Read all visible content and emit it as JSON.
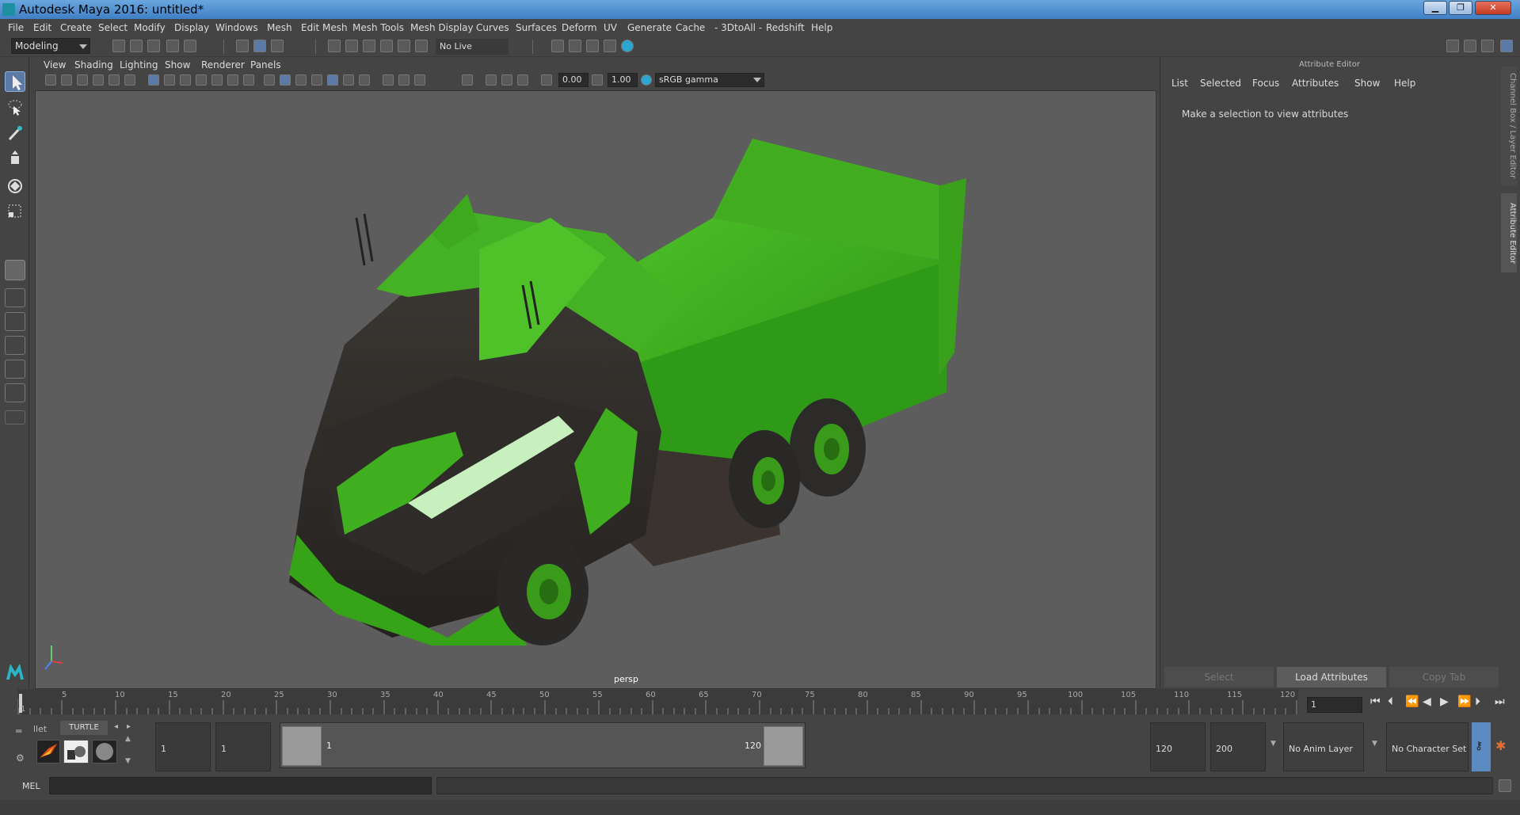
{
  "window": {
    "title": "Autodesk Maya 2016: untitled*",
    "min": "▁",
    "max": "❐",
    "close": "✕"
  },
  "menu": [
    "File",
    "Edit",
    "Create",
    "Select",
    "Modify",
    "Display",
    "Windows",
    "Mesh",
    "Edit Mesh",
    "Mesh Tools",
    "Mesh Display",
    "Curves",
    "Surfaces",
    "Deform",
    "UV",
    "Generate",
    "Cache",
    "- 3DtoAll -",
    "Redshift",
    "Help"
  ],
  "shelf": {
    "mode": "Modeling",
    "live_surface": "No Live Surface"
  },
  "viewport": {
    "menu": [
      "View",
      "Shading",
      "Lighting",
      "Show",
      "Renderer",
      "Panels"
    ],
    "exposure": "0.00",
    "gamma": "1.00",
    "color_space": "sRGB gamma",
    "camera": "persp"
  },
  "attribute_editor": {
    "title": "Attribute Editor",
    "menu": [
      "List",
      "Selected",
      "Focus",
      "Attributes",
      "Show",
      "Help"
    ],
    "message": "Make a selection to view attributes",
    "buttons": {
      "select": "Select",
      "load": "Load Attributes",
      "copy": "Copy Tab"
    },
    "side_tabs": {
      "channel_box": "Channel Box / Layer Editor",
      "attr_editor": "Attribute Editor"
    }
  },
  "timeline": {
    "ticks": [
      "5",
      "10",
      "15",
      "20",
      "25",
      "30",
      "35",
      "40",
      "45",
      "50",
      "55",
      "60",
      "65",
      "70",
      "75",
      "80",
      "85",
      "90",
      "95",
      "100",
      "105",
      "110",
      "115",
      "120"
    ],
    "start_marker": "1",
    "current_frame": "1"
  },
  "range": {
    "shelf_tab_prev": "llet",
    "shelf_tab": "TURTLE",
    "start": "1",
    "anim_start": "1",
    "slider_min": "1",
    "slider_max": "120",
    "end": "120",
    "anim_end": "200",
    "anim_layer": "No Anim Layer",
    "character_set": "No Character Set"
  },
  "command": {
    "lang": "MEL"
  },
  "colors": {
    "accent": "#5b7aa6",
    "truck_green": "#3fae1f",
    "viewport_bg": "#5d5d5d"
  }
}
